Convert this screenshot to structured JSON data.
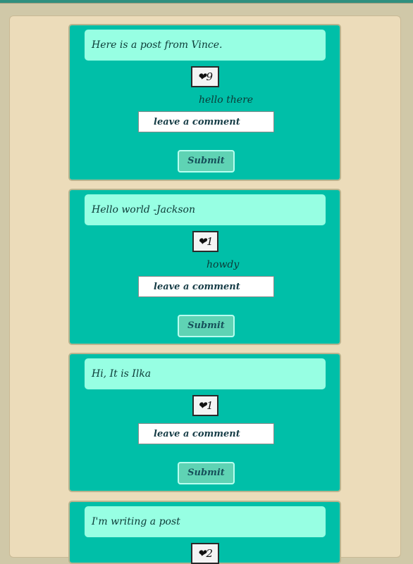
{
  "heart": "❤",
  "comment_placeholder": "leave a comment",
  "submit_label": "Submit",
  "colors": {
    "post_bg": "#00bfa8",
    "title_bg": "#97ffe3",
    "page_bg": "#ecdcba",
    "submit_bg": "#5fd3b4"
  },
  "posts": [
    {
      "title": "Here is a post from Vince.",
      "likes": "9",
      "comment": "hello there"
    },
    {
      "title": "Hello world -Jackson",
      "likes": "1",
      "comment": "howdy"
    },
    {
      "title": "Hi, It is Ilka",
      "likes": "1"
    },
    {
      "title": "I'm writing a post",
      "likes": "2"
    }
  ]
}
